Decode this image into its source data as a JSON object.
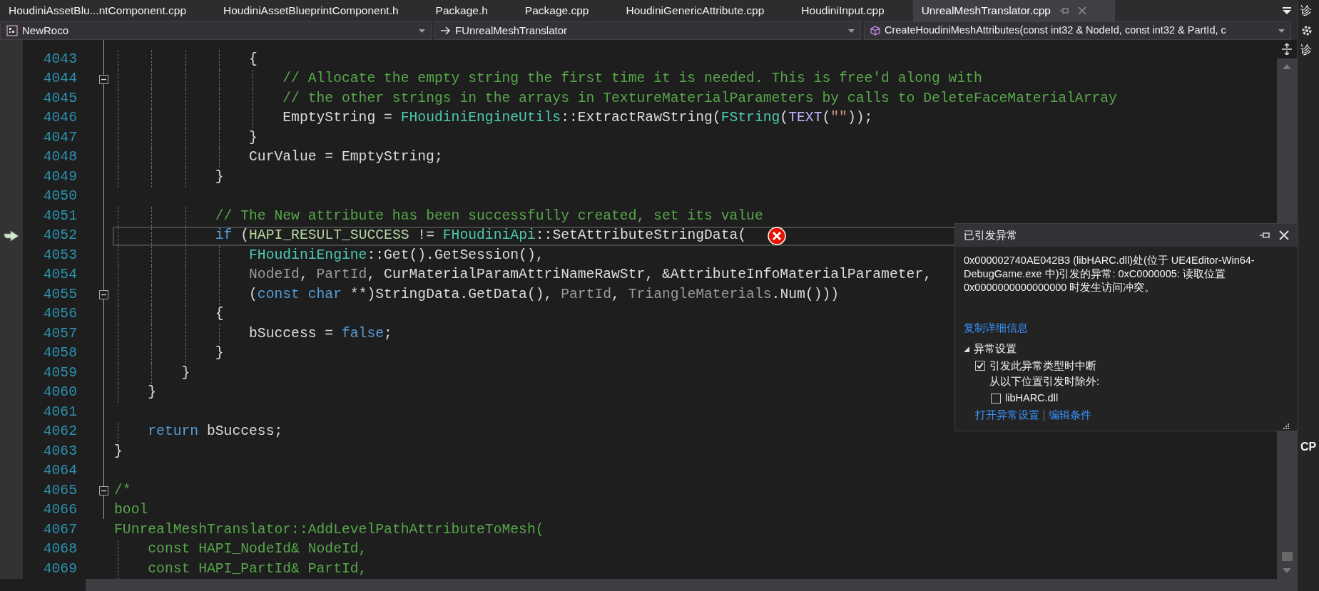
{
  "tabs": [
    {
      "label": "HoudiniAssetBlu...ntComponent.cpp",
      "selected": false
    },
    {
      "label": "HoudiniAssetBlueprintComponent.h",
      "selected": false
    },
    {
      "label": "Package.h",
      "selected": false
    },
    {
      "label": "Package.cpp",
      "selected": false
    },
    {
      "label": "HoudiniGenericAttribute.cpp",
      "selected": false
    },
    {
      "label": "HoudiniInput.cpp",
      "selected": false
    },
    {
      "label": "UnrealMeshTranslator.cpp",
      "selected": true
    }
  ],
  "navigation": {
    "project": "NewRoco",
    "scope": "FUnrealMeshTranslator",
    "member": "CreateHoudiniMeshAttributes(const int32 & NodeId, const int32 & PartId, c"
  },
  "editor": {
    "lines": [
      {
        "number": "4043",
        "fold_start": false,
        "current": false,
        "error": false,
        "tokens": [
          {
            "kind": "plain",
            "text": "                {"
          }
        ]
      },
      {
        "number": "4044",
        "fold_start": true,
        "current": false,
        "error": false,
        "tokens": [
          {
            "kind": "comment",
            "text": "                    // Allocate the empty string the first time it is needed. This is free'd along with"
          }
        ]
      },
      {
        "number": "4045",
        "fold_start": false,
        "current": false,
        "error": false,
        "tokens": [
          {
            "kind": "comment",
            "text": "                    // the other strings in the arrays in TextureMaterialParameters by calls to DeleteFaceMaterialArray"
          }
        ]
      },
      {
        "number": "4046",
        "fold_start": false,
        "current": false,
        "error": false,
        "tokens": [
          {
            "kind": "plain",
            "text": "                    EmptyString = "
          },
          {
            "kind": "type",
            "text": "FHoudiniEngineUtils"
          },
          {
            "kind": "plain",
            "text": "::ExtractRawString("
          },
          {
            "kind": "type",
            "text": "FString"
          },
          {
            "kind": "plain",
            "text": "("
          },
          {
            "kind": "macro",
            "text": "TEXT"
          },
          {
            "kind": "plain",
            "text": "("
          },
          {
            "kind": "string",
            "text": "\"\""
          },
          {
            "kind": "plain",
            "text": "));"
          }
        ]
      },
      {
        "number": "4047",
        "fold_start": false,
        "current": false,
        "error": false,
        "tokens": [
          {
            "kind": "plain",
            "text": "                }"
          }
        ]
      },
      {
        "number": "4048",
        "fold_start": false,
        "current": false,
        "error": false,
        "tokens": [
          {
            "kind": "plain",
            "text": "                CurValue = EmptyString;"
          }
        ]
      },
      {
        "number": "4049",
        "fold_start": false,
        "current": false,
        "error": false,
        "tokens": [
          {
            "kind": "plain",
            "text": "            }"
          }
        ]
      },
      {
        "number": "4050",
        "fold_start": false,
        "current": false,
        "error": false
      },
      {
        "number": "4051",
        "fold_start": false,
        "current": false,
        "error": false,
        "tokens": [
          {
            "kind": "comment",
            "text": "            // The New attribute has been successfully created, set its value"
          }
        ]
      },
      {
        "number": "4052",
        "fold_start": false,
        "current": true,
        "error": true,
        "tokens": [
          {
            "kind": "keyword",
            "text": "            if"
          },
          {
            "kind": "plain",
            "text": " ("
          },
          {
            "kind": "enum",
            "text": "HAPI_RESULT_SUCCESS"
          },
          {
            "kind": "plain",
            "text": " != "
          },
          {
            "kind": "type",
            "text": "FHoudiniApi"
          },
          {
            "kind": "plain",
            "text": "::SetAttributeStringData("
          }
        ]
      },
      {
        "number": "4053",
        "fold_start": false,
        "current": false,
        "error": false,
        "tokens": [
          {
            "kind": "type",
            "text": "                FHoudiniEngine"
          },
          {
            "kind": "plain",
            "text": "::Get().GetSession(),"
          }
        ]
      },
      {
        "number": "4054",
        "fold_start": false,
        "current": false,
        "error": false,
        "tokens": [
          {
            "kind": "param",
            "text": "                NodeId"
          },
          {
            "kind": "plain",
            "text": ", "
          },
          {
            "kind": "param",
            "text": "PartId"
          },
          {
            "kind": "plain",
            "text": ", CurMaterialParamAttriNameRawStr, &AttributeInfoMaterialParameter,"
          }
        ]
      },
      {
        "number": "4055",
        "fold_start": true,
        "current": false,
        "error": false,
        "tokens": [
          {
            "kind": "plain",
            "text": "                ("
          },
          {
            "kind": "keyword",
            "text": "const char"
          },
          {
            "kind": "plain",
            "text": " **)StringData.GetData(), "
          },
          {
            "kind": "param",
            "text": "PartId"
          },
          {
            "kind": "plain",
            "text": ", "
          },
          {
            "kind": "param",
            "text": "TriangleMaterials"
          },
          {
            "kind": "plain",
            "text": ".Num()))"
          }
        ]
      },
      {
        "number": "4056",
        "fold_start": false,
        "current": false,
        "error": false,
        "tokens": [
          {
            "kind": "plain",
            "text": "            {"
          }
        ]
      },
      {
        "number": "4057",
        "fold_start": false,
        "current": false,
        "error": false,
        "tokens": [
          {
            "kind": "plain",
            "text": "                bSuccess = "
          },
          {
            "kind": "keyword",
            "text": "false"
          },
          {
            "kind": "plain",
            "text": ";"
          }
        ]
      },
      {
        "number": "4058",
        "fold_start": false,
        "current": false,
        "error": false,
        "tokens": [
          {
            "kind": "plain",
            "text": "            }"
          }
        ]
      },
      {
        "number": "4059",
        "fold_start": false,
        "current": false,
        "error": false,
        "tokens": [
          {
            "kind": "plain",
            "text": "        }"
          }
        ]
      },
      {
        "number": "4060",
        "fold_start": false,
        "current": false,
        "error": false,
        "tokens": [
          {
            "kind": "plain",
            "text": "    }"
          }
        ]
      },
      {
        "number": "4061",
        "fold_start": false,
        "current": false,
        "error": false
      },
      {
        "number": "4062",
        "fold_start": false,
        "current": false,
        "error": false,
        "tokens": [
          {
            "kind": "keyword",
            "text": "    return"
          },
          {
            "kind": "plain",
            "text": " bSuccess;"
          }
        ]
      },
      {
        "number": "4063",
        "fold_start": false,
        "current": false,
        "error": false,
        "tokens": [
          {
            "kind": "plain",
            "text": "}"
          }
        ]
      },
      {
        "number": "4064",
        "fold_start": false,
        "current": false,
        "error": false
      },
      {
        "number": "4065",
        "fold_start": true,
        "current": false,
        "error": false,
        "tokens": [
          {
            "kind": "comment",
            "text": "/*"
          }
        ]
      },
      {
        "number": "4066",
        "fold_start": false,
        "current": false,
        "error": false,
        "tokens": [
          {
            "kind": "comment",
            "text": "bool"
          }
        ]
      },
      {
        "number": "4067",
        "fold_start": false,
        "current": false,
        "error": false,
        "tokens": [
          {
            "kind": "comment",
            "text": "FUnrealMeshTranslator::AddLevelPathAttributeToMesh("
          }
        ]
      },
      {
        "number": "4068",
        "fold_start": false,
        "current": false,
        "error": false,
        "tokens": [
          {
            "kind": "comment",
            "text": "    const HAPI_NodeId& NodeId,"
          }
        ]
      },
      {
        "number": "4069",
        "fold_start": false,
        "current": false,
        "error": false,
        "tokens": [
          {
            "kind": "comment",
            "text": "    const HAPI_PartId& PartId,"
          }
        ]
      }
    ]
  },
  "exception_popup": {
    "title": "已引发异常",
    "message": "0x000002740AE042B3 (libHARC.dll)处(位于 UE4Editor-Win64-DebugGame.exe 中)引发的异常: 0xC0000005: 读取位置 0x0000000000000000 时发生访问冲突。",
    "copy_link": "复制详细信息",
    "settings": {
      "label": "异常设置",
      "expanded": true,
      "break_option": {
        "label": "引发此异常类型时中断",
        "checked": true
      },
      "except_label": "从以下位置引发时除外:",
      "exclusions": [
        {
          "label": "libHARC.dll",
          "checked": false
        }
      ],
      "links": [
        "打开异常设置",
        "编辑条件"
      ]
    }
  },
  "right_panel": {
    "tab": "诊",
    "title": "诊",
    "section": "CP"
  }
}
